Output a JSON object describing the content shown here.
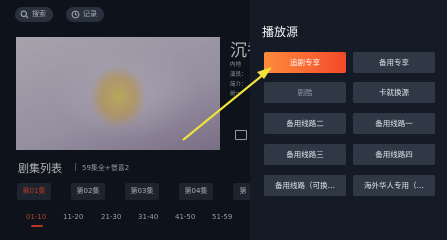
{
  "topbar": {
    "search_label": "搜索",
    "history_label": "记录"
  },
  "detail": {
    "title": "沉香",
    "meta_lines": [
      "内地",
      "演员：",
      "简介：",
      "前一"
    ]
  },
  "episodes": {
    "title": "剧集列表",
    "summary": "59集全+憬喜2",
    "items": [
      "第01集",
      "第02集",
      "第03集",
      "第04集",
      "第"
    ],
    "active_index": 0,
    "ranges": [
      "01-10",
      "11-20",
      "21-30",
      "31-40",
      "41-50",
      "51-59"
    ],
    "active_range_index": 0
  },
  "source_panel": {
    "title": "播放源",
    "sources": [
      {
        "label": "追剧专享",
        "state": "active"
      },
      {
        "label": "备用专享",
        "state": "normal"
      },
      {
        "label": "剧酷",
        "state": "dim"
      },
      {
        "label": "卡就换源",
        "state": "normal"
      },
      {
        "label": "备用线路二",
        "state": "normal"
      },
      {
        "label": "备用线路一",
        "state": "normal"
      },
      {
        "label": "备用线路三",
        "state": "normal"
      },
      {
        "label": "备用线路四",
        "state": "normal"
      },
      {
        "label": "备用线路（可换…",
        "state": "normal"
      },
      {
        "label": "海外华人专用（…",
        "state": "normal"
      }
    ]
  },
  "colors": {
    "accent": "#ff4b34",
    "arrow": "#f0e23a"
  }
}
